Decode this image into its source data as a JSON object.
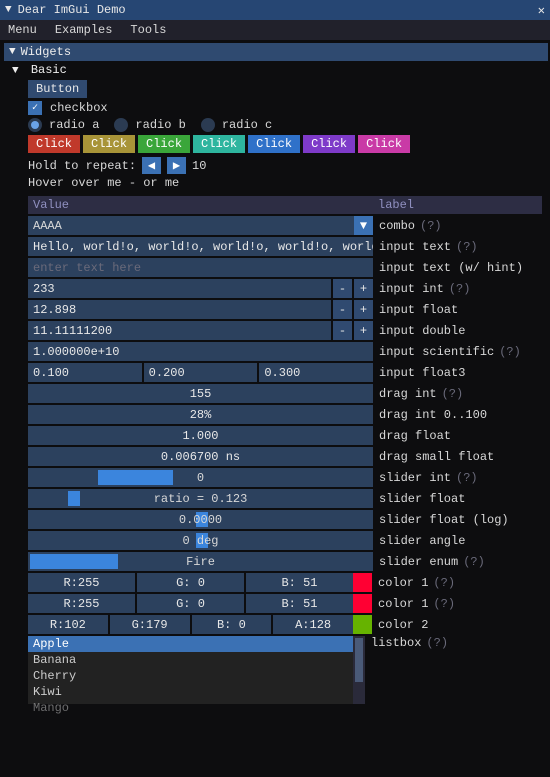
{
  "window": {
    "title": "Dear ImGui Demo"
  },
  "menubar": [
    "Menu",
    "Examples",
    "Tools"
  ],
  "tree": {
    "widgets": "Widgets",
    "basic": "Basic"
  },
  "button_label": "Button",
  "checkbox_label": "checkbox",
  "radios": [
    "radio a",
    "radio b",
    "radio c"
  ],
  "click_buttons": [
    {
      "label": "Click",
      "bg": "#c0392b"
    },
    {
      "label": "Click",
      "bg": "#a89438"
    },
    {
      "label": "Click",
      "bg": "#3aa63a"
    },
    {
      "label": "Click",
      "bg": "#2eb59f"
    },
    {
      "label": "Click",
      "bg": "#2f71c9"
    },
    {
      "label": "Click",
      "bg": "#7e3ac9"
    },
    {
      "label": "Click",
      "bg": "#c93aa6"
    }
  ],
  "repeat": {
    "text": "Hold to repeat:",
    "value": "10"
  },
  "hover_text": "Hover over me - or me",
  "cols": {
    "value": "Value",
    "label": "label"
  },
  "combo": {
    "value": "AAAA",
    "label": "combo"
  },
  "input_text": {
    "value": "Hello, world!o, world!o, world!o, world!o, world",
    "label": "input text"
  },
  "input_hint": {
    "placeholder": "enter text here",
    "label": "input text (w/ hint)"
  },
  "input_int": {
    "value": "233",
    "label": "input int"
  },
  "input_float": {
    "value": "12.898",
    "label": "input float"
  },
  "input_double": {
    "value": "11.11111200",
    "label": "input double"
  },
  "input_sci": {
    "value": "1.000000e+10",
    "label": "input scientific"
  },
  "input_float3": {
    "v0": "0.100",
    "v1": "0.200",
    "v2": "0.300",
    "label": "input float3"
  },
  "drag_int": {
    "value": "155",
    "label": "drag int"
  },
  "drag_int_0_100": {
    "value": "28%",
    "label": "drag int 0..100"
  },
  "drag_float": {
    "value": "1.000",
    "label": "drag float"
  },
  "drag_small": {
    "value": "0.006700 ns",
    "label": "drag small float"
  },
  "slider_int": {
    "value": "0",
    "label": "slider int"
  },
  "slider_float": {
    "value": "ratio = 0.123",
    "label": "slider float"
  },
  "slider_log": {
    "value": "0.0000",
    "label": "slider float (log)"
  },
  "slider_angle": {
    "value": "0 deg",
    "label": "slider angle"
  },
  "slider_enum": {
    "value": "Fire",
    "label": "slider enum"
  },
  "color1a": {
    "r": "R:255",
    "g": "G:  0",
    "b": "B: 51",
    "hex": "#ff0033",
    "label": "color 1"
  },
  "color1b": {
    "r": "R:255",
    "g": "G:  0",
    "b": "B: 51",
    "hex": "#ff0033",
    "label": "color 1"
  },
  "color2": {
    "r": "R:102",
    "g": "G:179",
    "b": "B:  0",
    "a": "A:128",
    "hex": "#66b300",
    "label": "color 2"
  },
  "listbox": {
    "items": [
      "Apple",
      "Banana",
      "Cherry",
      "Kiwi",
      "Mango"
    ],
    "selected": 0,
    "label": "listbox"
  },
  "help": "(?)"
}
